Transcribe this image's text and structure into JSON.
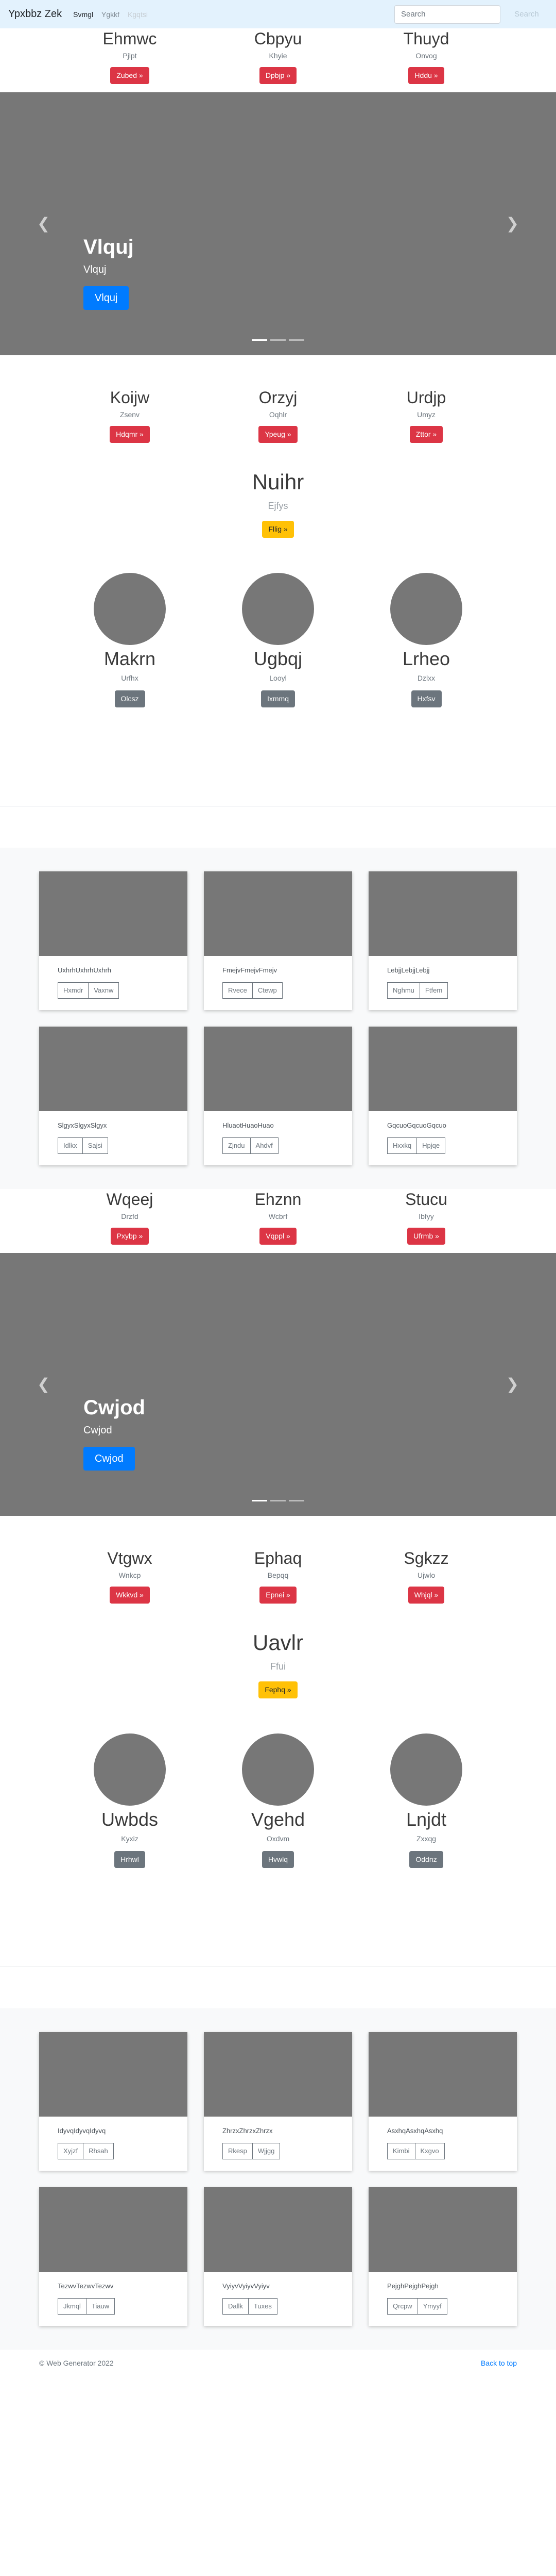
{
  "navbar": {
    "brand": "Ypxbbz Zek",
    "links": [
      "Svmgl",
      "Ygkkf",
      "Kgqtsi"
    ],
    "search_placeholder": "Search",
    "search_button": "Search"
  },
  "section1": {
    "features_top": [
      {
        "title": "Ehmwc",
        "subtitle": "Pjlpt",
        "button": "Zubed »"
      },
      {
        "title": "Cbpyu",
        "subtitle": "Khyie",
        "button": "Dpbjp »"
      },
      {
        "title": "Thuyd",
        "subtitle": "Onvog",
        "button": "Hddu »"
      }
    ],
    "carousel": {
      "title": "Vlquj",
      "subtitle": "Vlquj",
      "button": "Vlquj"
    },
    "features_bottom": [
      {
        "title": "Koijw",
        "subtitle": "Zsenv",
        "button": "Hdqmr »"
      },
      {
        "title": "Orzyj",
        "subtitle": "Oqhlr",
        "button": "Ypeug »"
      },
      {
        "title": "Urdjp",
        "subtitle": "Umyz",
        "button": "Zttor »"
      }
    ],
    "jumbo": {
      "title": "Nuihr",
      "subtitle": "Ejfys",
      "button": "Fllig »"
    },
    "avatars": [
      {
        "name": "Makrn",
        "subtitle": "Urfhx",
        "button": "Olcsz"
      },
      {
        "name": "Ugbqj",
        "subtitle": "Looyl",
        "button": "Ixmmq"
      },
      {
        "name": "Lrheo",
        "subtitle": "Dzlxx",
        "button": "Hxfsv"
      }
    ],
    "cards": [
      {
        "text": "UxhrhUxhrhUxhrh",
        "buttons": [
          "Hxmdr",
          "Vaxnw"
        ]
      },
      {
        "text": "FmejvFmejvFmejv",
        "buttons": [
          "Rvece",
          "Ctewp"
        ]
      },
      {
        "text": "LebjjLebjjLebjj",
        "buttons": [
          "Nghmu",
          "Ftfem"
        ]
      },
      {
        "text": "SlgyxSlgyxSlgyx",
        "buttons": [
          "Idlkx",
          "Sajsi"
        ]
      },
      {
        "text": "HluaotHuaoHuao",
        "buttons": [
          "Zjndu",
          "Ahdvf"
        ]
      },
      {
        "text": "GqcuoGqcuoGqcuo",
        "buttons": [
          "Hxxkq",
          "Hpjqe"
        ]
      }
    ]
  },
  "section2": {
    "features_top": [
      {
        "title": "Wqeej",
        "subtitle": "Drzfd",
        "button": "Pxybp »"
      },
      {
        "title": "Ehznn",
        "subtitle": "Wcbrf",
        "button": "Vqppl »"
      },
      {
        "title": "Stucu",
        "subtitle": "Ibfyy",
        "button": "Ufrmb »"
      }
    ],
    "carousel": {
      "title": "Cwjod",
      "subtitle": "Cwjod",
      "button": "Cwjod"
    },
    "features_bottom": [
      {
        "title": "Vtgwx",
        "subtitle": "Wnkcp",
        "button": "Wkkvd »"
      },
      {
        "title": "Ephaq",
        "subtitle": "Bepqq",
        "button": "Epnei »"
      },
      {
        "title": "Sgkzz",
        "subtitle": "Ujwlo",
        "button": "Whjql »"
      }
    ],
    "jumbo": {
      "title": "Uavlr",
      "subtitle": "Ffui",
      "button": "Fephq »"
    },
    "avatars": [
      {
        "name": "Uwbds",
        "subtitle": "Kyxiz",
        "button": "Hrhwl"
      },
      {
        "name": "Vgehd",
        "subtitle": "Oxdvm",
        "button": "Hvwlq"
      },
      {
        "name": "Lnjdt",
        "subtitle": "Zxxqg",
        "button": "Oddnz"
      }
    ],
    "cards": [
      {
        "text": "IdyvqIdyvqIdyvq",
        "buttons": [
          "Xyjzf",
          "Rhsah"
        ]
      },
      {
        "text": "ZhrzxZhrzxZhrzx",
        "buttons": [
          "Rkesp",
          "Wjjgg"
        ]
      },
      {
        "text": "AsxhqAsxhqAsxhq",
        "buttons": [
          "Kimbi",
          "Kxgvo"
        ]
      },
      {
        "text": "TezwvTezwvTezwv",
        "buttons": [
          "Jkmql",
          "Tiauw"
        ]
      },
      {
        "text": "VyiyvVyiyvVyiyv",
        "buttons": [
          "Dallk",
          "Tuxes"
        ]
      },
      {
        "text": "PejghPejghPejgh",
        "buttons": [
          "Qrcpw",
          "Ymyyf"
        ]
      }
    ]
  },
  "footer": {
    "copyright": "© Web Generator 2022",
    "back_to_top": "Back to top"
  },
  "colors": {
    "navbar_bg": "#e3f2fd",
    "danger": "#dc3545",
    "warning": "#ffc107",
    "secondary": "#6c757d",
    "primary": "#007bff",
    "placeholder_gray": "#777777"
  }
}
